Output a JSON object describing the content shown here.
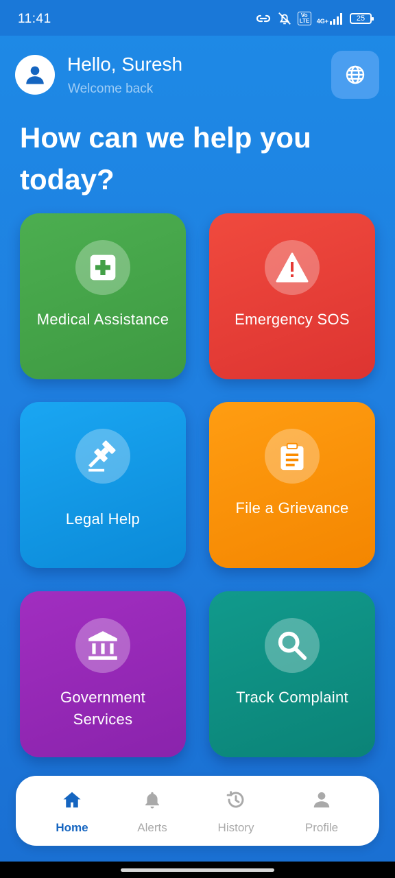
{
  "status_bar": {
    "time": "11:41",
    "net_top": "4G+",
    "volte": "Vo LTE",
    "battery": "25"
  },
  "header": {
    "greeting": "Hello, Suresh",
    "subtitle": "Welcome back",
    "avatar_icon": "person-icon",
    "language_icon": "globe-icon"
  },
  "title": "How can we help you today?",
  "tiles": [
    {
      "label": "Medical Assistance",
      "icon": "medical-cross-icon",
      "color": "#43a047"
    },
    {
      "label": "Emergency SOS",
      "icon": "warning-icon",
      "color": "#e53935"
    },
    {
      "label": "Legal Help",
      "icon": "gavel-icon",
      "color": "#039be5"
    },
    {
      "label": "File a Grievance",
      "icon": "clipboard-icon",
      "color": "#fb8c00"
    },
    {
      "label": "Government Services",
      "icon": "bank-icon",
      "color": "#8e24aa"
    },
    {
      "label": "Track Complaint",
      "icon": "search-icon",
      "color": "#00897b"
    }
  ],
  "nav": {
    "active": "Home",
    "items": [
      {
        "label": "Home",
        "icon": "home-icon"
      },
      {
        "label": "Alerts",
        "icon": "bell-icon"
      },
      {
        "label": "History",
        "icon": "history-icon"
      },
      {
        "label": "Profile",
        "icon": "person-icon"
      }
    ]
  },
  "colors": {
    "background": "#1e88e5",
    "active_nav": "#1565c0",
    "inactive_nav": "#a9a9a9"
  }
}
